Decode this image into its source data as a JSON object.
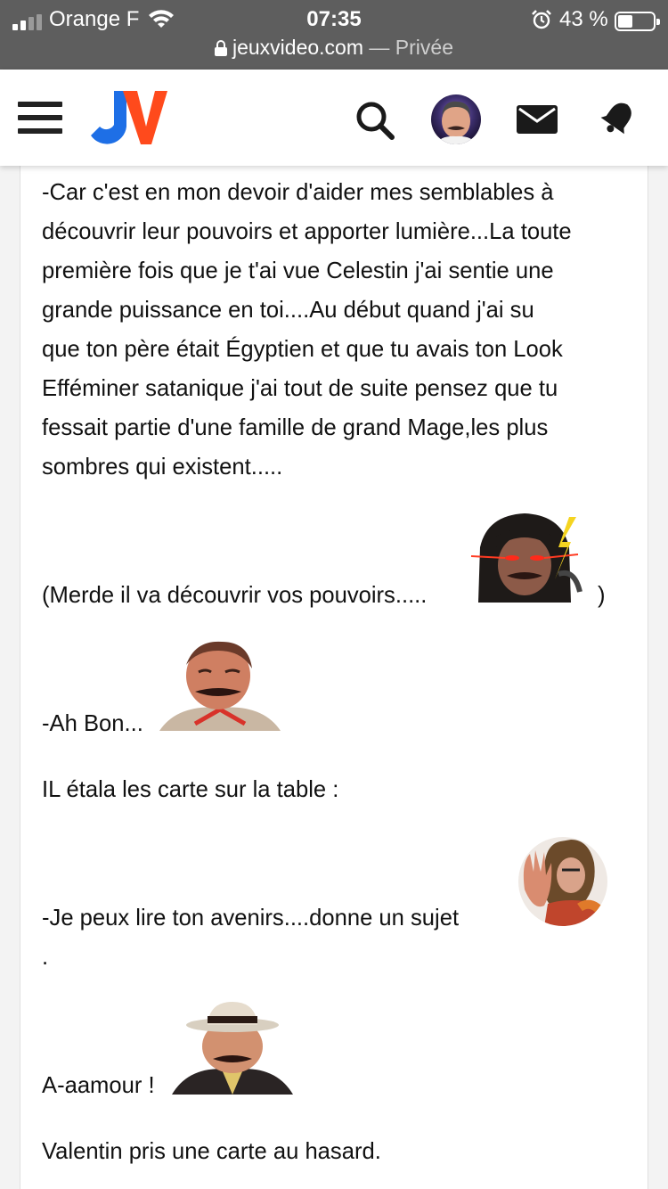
{
  "status_bar": {
    "carrier": "Orange F",
    "time": "07:35",
    "battery": "43 %",
    "battery_level": 0.43
  },
  "browser": {
    "host": "jeuxvideo.com",
    "separator": "—",
    "mode": "Privée"
  },
  "header": {
    "logo_text": "JV",
    "colors": {
      "logo_blue": "#1e6fe6",
      "logo_orange": "#ff4a1c"
    }
  },
  "post": {
    "paragraph_lines": [
      "-Car c'est en mon devoir d'aider mes semblables à",
      "découvrir leur pouvoirs et apporter lumière...La toute",
      "première fois que je t'ai vue Celestin j'ai sentie une",
      "grande puissance en toi....Au début quand j'ai su",
      "que ton père était Égyptien et que tu avais ton Look",
      "Efféminer satanique j'ai tout de suite pensez que tu",
      "fessait partie d'une famille de grand Mage,les plus",
      "sombres qui existent....."
    ],
    "line_merde": "(Merde il va découvrir vos pouvoirs.....",
    "line_merde_close": ")",
    "line_ahbon": "-Ah Bon...",
    "line_etala": "IL étala les carte sur la table :",
    "line_lire": "-Je peux lire ton avenirs....donne un sujet",
    "line_dot": ".",
    "line_amour": "A-aamour !",
    "line_valentin": "Valentin pris une carte au hasard."
  }
}
